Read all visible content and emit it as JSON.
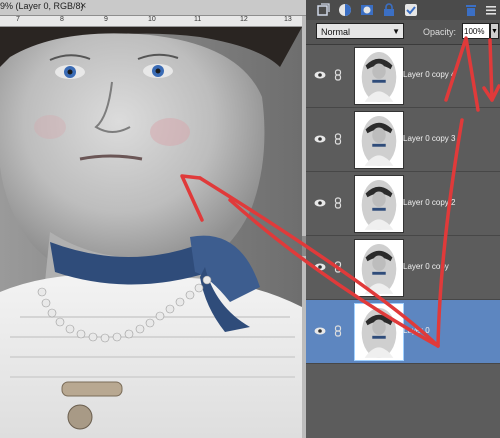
{
  "document": {
    "tab_title": "9% (Layer 0, RGB/8)",
    "close_glyph": "×",
    "ruler_labels": [
      "7",
      "8",
      "9",
      "10",
      "11",
      "12",
      "13"
    ]
  },
  "panel": {
    "toolbar_icons": [
      "new-layer-icon",
      "adjustment-layer-icon",
      "layer-mask-icon",
      "lock-icon",
      "lock-all-icon",
      "trash-icon",
      "panel-menu-icon"
    ],
    "blend_mode": "Normal",
    "opacity_label": "Opacity:",
    "opacity_value": "100%",
    "layers": [
      {
        "name": "Layer 0 copy 4",
        "selected": false
      },
      {
        "name": "Layer 0 copy 3",
        "selected": false
      },
      {
        "name": "Layer 0 copy 2",
        "selected": false
      },
      {
        "name": "Layer 0 copy",
        "selected": false
      },
      {
        "name": "Layer 0",
        "selected": true
      }
    ]
  },
  "colors": {
    "selection_blue": "#5d86c0",
    "annotation_red": "#e03a3a",
    "ribbon_blue": "#2f4c7a",
    "eye_blue": "#3a6bb5"
  }
}
